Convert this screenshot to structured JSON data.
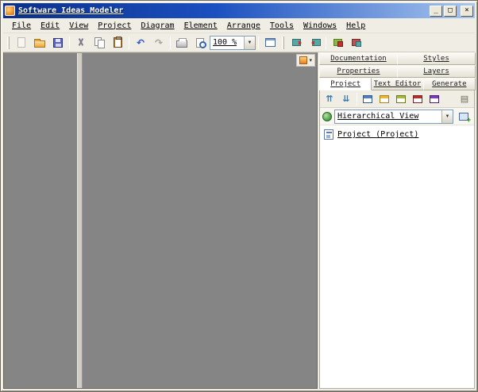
{
  "window": {
    "title": "Software Ideas Modeler"
  },
  "titlebar": {
    "minimize": "_",
    "maximize": "□",
    "close": "×"
  },
  "menu": {
    "items": [
      {
        "label": "File"
      },
      {
        "label": "Edit"
      },
      {
        "label": "View"
      },
      {
        "label": "Project"
      },
      {
        "label": "Diagram"
      },
      {
        "label": "Element"
      },
      {
        "label": "Arrange"
      },
      {
        "label": "Tools"
      },
      {
        "label": "Windows"
      },
      {
        "label": "Help"
      }
    ]
  },
  "toolbar": {
    "zoom_value": "100 %",
    "buttons": [
      "new",
      "open",
      "save",
      "cut",
      "copy",
      "paste",
      "undo",
      "redo",
      "print",
      "print-preview",
      "fit-page",
      "tool-1",
      "tool-2",
      "tool-3",
      "tool-4"
    ]
  },
  "icons": {
    "undo": "↶",
    "redo": "↷",
    "dropdown": "▼",
    "small_dropdown": "▾",
    "collapse_all": "⇈",
    "expand_all": "⇊",
    "panel_menu": "▤"
  },
  "right_panel": {
    "tab_rows": {
      "row1": [
        {
          "label": "Documentation"
        },
        {
          "label": "Styles"
        }
      ],
      "row2": [
        {
          "label": "Properties"
        },
        {
          "label": "Layers"
        }
      ],
      "row3": [
        {
          "label": "Project"
        },
        {
          "label": "Text Editor"
        },
        {
          "label": "Generate"
        }
      ]
    },
    "active_tab": "Project",
    "project_panel": {
      "view_select_value": "Hierarchical View",
      "tree_items": [
        {
          "label": "Project (Project)"
        }
      ]
    }
  },
  "colors": {
    "titlebar_gradient_start": "#0b2f8a",
    "titlebar_gradient_end": "#a8c6ef",
    "chrome": "#f0eee4",
    "canvas_gray": "#858585",
    "folder_orange": "#e8a33d",
    "combo_border": "#7f9db9"
  }
}
